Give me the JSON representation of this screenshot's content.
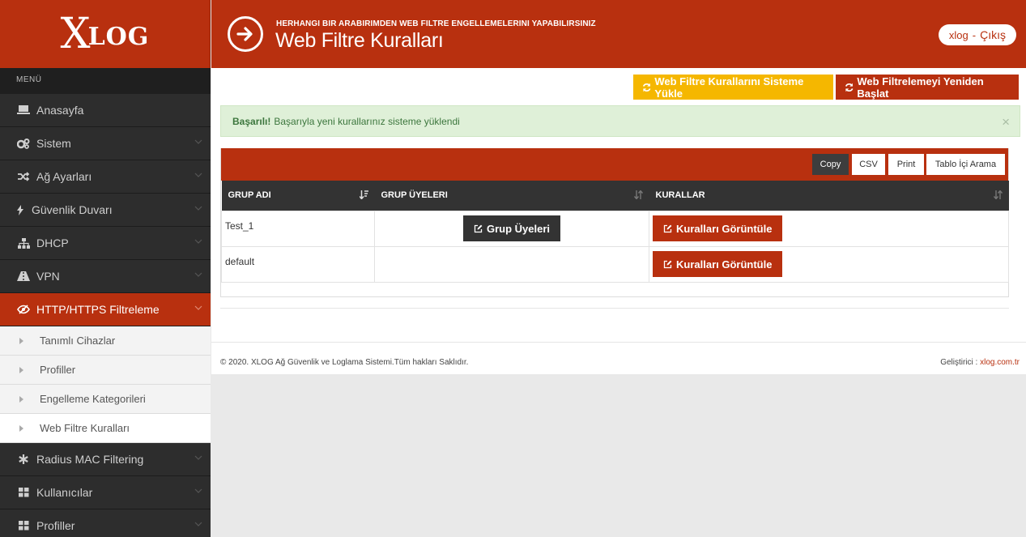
{
  "logo": {
    "initial": "X",
    "rest": "LOG"
  },
  "header": {
    "subtitle": "HERHANGI BIR ARABIRIMDEN WEB FILTRE ENGELLEMELERINI YAPABILIRSINIZ",
    "title": "Web Filtre Kuralları",
    "user": "xlog",
    "separator": "-",
    "logout": "Çıkış"
  },
  "sidebar": {
    "menu_label": "MENÜ",
    "items": [
      {
        "label": "Anasayfa",
        "icon": "laptop-icon"
      },
      {
        "label": "Sistem",
        "icon": "gears-icon"
      },
      {
        "label": "Ağ Ayarları",
        "icon": "shuffle-icon"
      },
      {
        "label": "Güvenlik Duvarı",
        "icon": "bolt-icon"
      },
      {
        "label": "DHCP",
        "icon": "sitemap-icon"
      },
      {
        "label": "VPN",
        "icon": "road-icon"
      },
      {
        "label": "HTTP/HTTPS Filtreleme",
        "icon": "eye-slash-icon"
      }
    ],
    "sub_items": [
      {
        "label": "Tanımlı Cihazlar"
      },
      {
        "label": "Profiller"
      },
      {
        "label": "Engelleme Kategorileri"
      },
      {
        "label": "Web Filtre Kuralları"
      }
    ],
    "bottom_items": [
      {
        "label": "Radius MAC Filtering",
        "icon": "asterisk-icon"
      },
      {
        "label": "Kullanıcılar",
        "icon": "th-icon"
      },
      {
        "label": "Profiller",
        "icon": "th-icon"
      }
    ]
  },
  "actions": {
    "load_rules": "Web Filtre Kurallarını Sisteme Yükle",
    "restart_filter": "Web Filtrelemeyi Yeniden Başlat"
  },
  "alert": {
    "strong": "Başarılı!",
    "message": "Başarıyla yeni kurallarınız sisteme yüklendi",
    "close": "×"
  },
  "table": {
    "buttons": {
      "copy": "Copy",
      "csv": "CSV",
      "print": "Print",
      "search": "Tablo İçi Arama"
    },
    "columns": [
      "GRUP ADI",
      "GRUP ÜYELERI",
      "KURALLAR"
    ],
    "rows": [
      {
        "name": "Test_1",
        "members_btn": "Grup Üyeleri",
        "rules_btn": "Kuralları Görüntüle"
      },
      {
        "name": "default",
        "members_btn": "",
        "rules_btn": "Kuralları Görüntüle"
      }
    ]
  },
  "footer": {
    "copyright": "© 2020. XLOG Ağ Güvenlik ve Loglama Sistemi.Tüm hakları Saklıdır.",
    "dev_label": "Geliştirici :",
    "dev_link": "xlog.com.tr"
  },
  "colors": {
    "brand": "#b8300f",
    "warning": "#f5b700",
    "sidebar": "#2b2b2b"
  }
}
